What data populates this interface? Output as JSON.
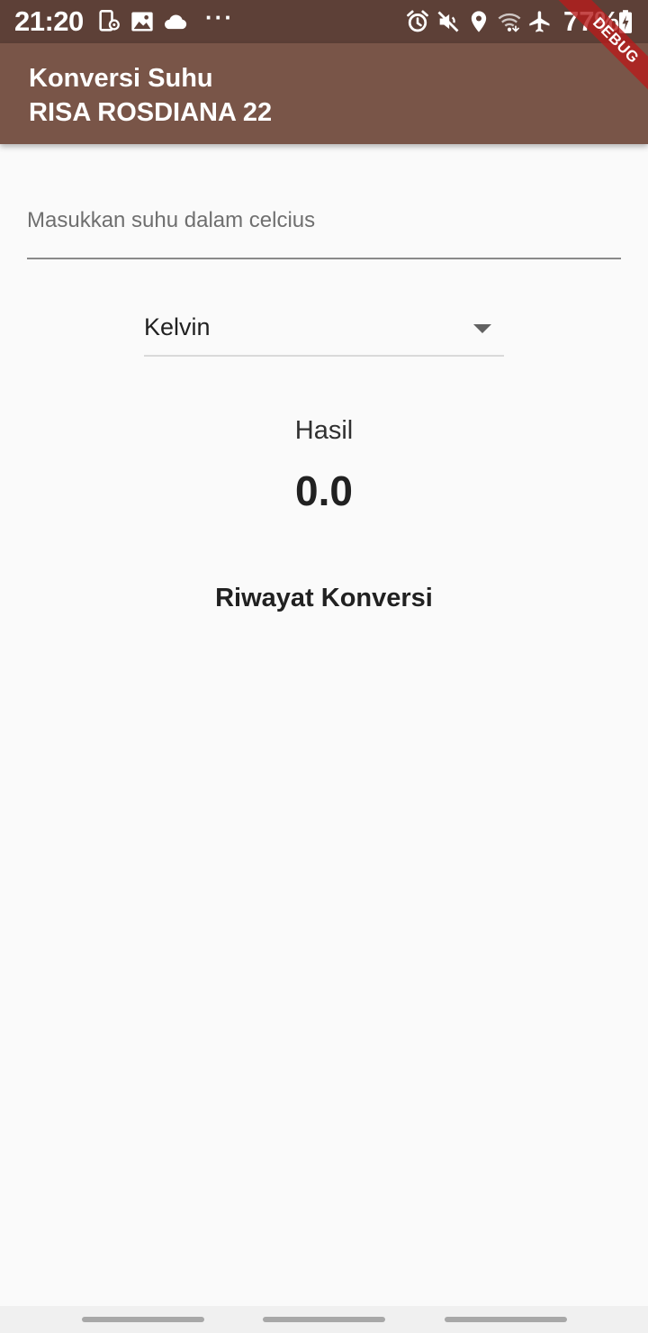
{
  "status_bar": {
    "time": "21:20",
    "more_indicator": "···",
    "battery": "77%",
    "left_icons": [
      "location-phone-icon",
      "image-icon",
      "cloud-icon"
    ],
    "right_icons": [
      "alarm-icon",
      "mute-icon",
      "location-icon",
      "wifi-icon",
      "airplane-icon",
      "battery-charging-icon"
    ]
  },
  "app_bar": {
    "title_line1": "Konversi Suhu",
    "title_line2": "RISA ROSDIANA 22"
  },
  "debug_banner": "DEBUG",
  "form": {
    "input_placeholder": "Masukkan suhu dalam celcius",
    "input_value": "",
    "selected_unit": "Kelvin"
  },
  "result": {
    "label": "Hasil",
    "value": "0.0"
  },
  "history": {
    "title": "Riwayat Konversi"
  },
  "colors": {
    "status_bar": "#5d4037",
    "app_bar": "#795548",
    "background": "#fafafa",
    "debug_ribbon": "#b71c1c"
  }
}
